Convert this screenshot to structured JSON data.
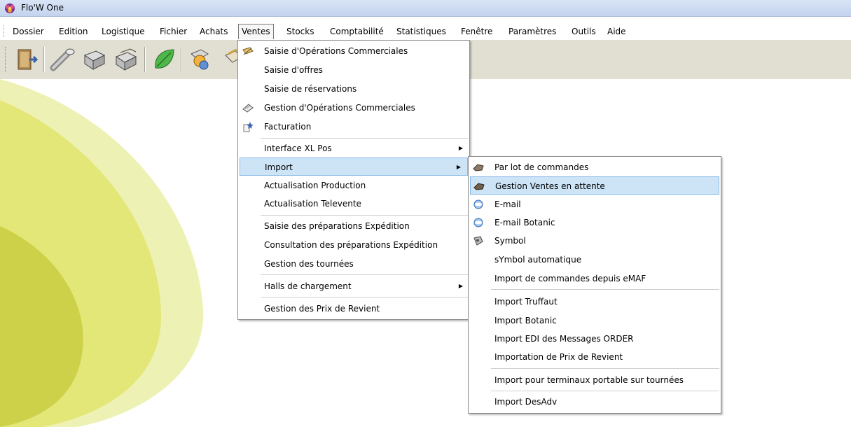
{
  "window": {
    "title": "Flo'W One"
  },
  "menubar": {
    "items": [
      "Dossier",
      "Edition",
      "Logistique",
      "Fichier",
      "Achats",
      "Ventes",
      "Stocks",
      "Comptabilité",
      "Statistiques",
      "Fenêtre",
      "Paramètres",
      "Outils",
      "Aide"
    ]
  },
  "toolbar": {
    "buttons": [
      "exit-door-icon",
      "pipe-icon",
      "crates-icon",
      "crates-stack-icon",
      "green-leaf-icon",
      "user-coin-icon",
      "clipboard-icon"
    ]
  },
  "ventes_menu": {
    "items": [
      {
        "label": "Saisie d'Opérations Commerciales",
        "icon": "ribbon-pen-icon"
      },
      {
        "label": "Saisie d'offres"
      },
      {
        "label": "Saisie de réservations"
      },
      {
        "label": "Gestion d'Opérations Commerciales",
        "icon": "stamp-icon"
      },
      {
        "label": "Facturation",
        "icon": "invoice-star-icon"
      },
      {
        "label": "Interface XL Pos",
        "submenu": true
      },
      {
        "label": "Import",
        "submenu": true,
        "highlighted": true
      },
      {
        "label": "Actualisation Production"
      },
      {
        "label": "Actualisation Televente"
      },
      {
        "label": "Saisie des préparations Expédition"
      },
      {
        "label": "Consultation des préparations Expédition"
      },
      {
        "label": "Gestion des tournées"
      },
      {
        "label": "Halls de chargement",
        "submenu": true
      },
      {
        "label": "Gestion des Prix de Revient"
      }
    ]
  },
  "import_menu": {
    "items": [
      {
        "label": "Par lot de commandes",
        "icon": "rock-icon"
      },
      {
        "label": "Gestion Ventes en attente",
        "icon": "rock-icon",
        "highlighted": true
      },
      {
        "label": "E-mail",
        "icon": "mail-globe-icon"
      },
      {
        "label": "E-mail Botanic",
        "icon": "mail-globe-icon"
      },
      {
        "label": "Symbol",
        "icon": "scanner-icon"
      },
      {
        "label": "sYmbol automatique"
      },
      {
        "label": "Import de commandes depuis eMAF"
      },
      {
        "label": "Import Truffaut"
      },
      {
        "label": "Import Botanic"
      },
      {
        "label": "Import EDI des Messages ORDER"
      },
      {
        "label": "Importation de Prix de Revient"
      },
      {
        "label": "Import pour terminaux portable sur tournées"
      },
      {
        "label": "Import DesAdv"
      }
    ]
  },
  "colors": {
    "highlight": "#cde4f7",
    "highlight_border": "#87b9e6",
    "toolbar_bg": "#e0dfd2",
    "titlebar": "#c8d6ef",
    "backdrop_yellow": "#dfe36b"
  }
}
